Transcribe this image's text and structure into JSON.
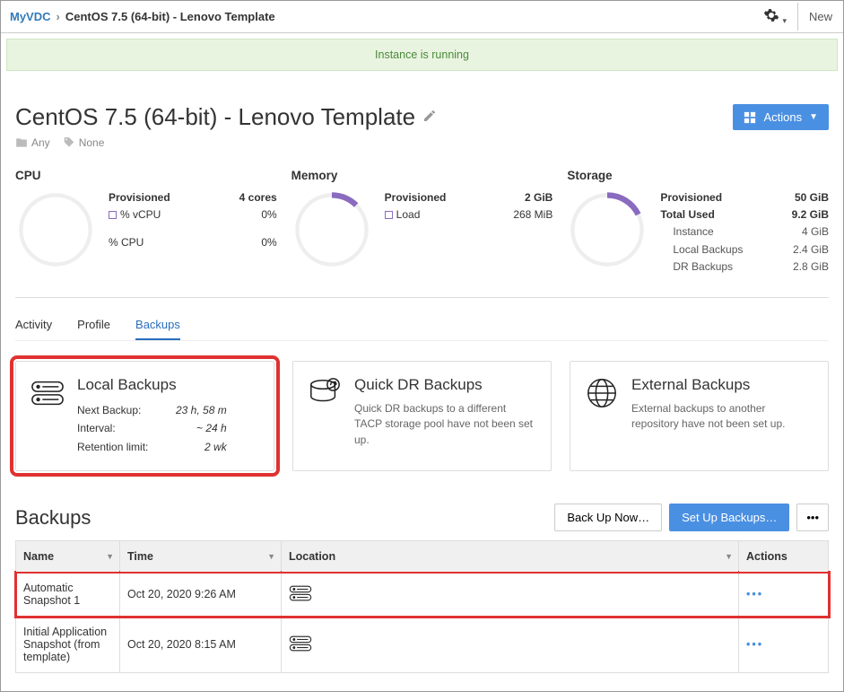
{
  "breadcrumb": {
    "root": "MyVDC",
    "current": "CentOS 7.5 (64-bit) - Lenovo Template"
  },
  "header": {
    "new_label": "New"
  },
  "status_banner": "Instance is running",
  "page_title": "CentOS 7.5 (64-bit) - Lenovo Template",
  "actions_dropdown": "Actions",
  "tags": {
    "folder": "Any",
    "tag": "None"
  },
  "gauges": {
    "cpu": {
      "title": "CPU",
      "rows": [
        {
          "label": "Provisioned",
          "value": "4 cores",
          "bold": true
        },
        {
          "label": "% vCPU",
          "value": "0%",
          "sq": true
        },
        {
          "label": "% CPU",
          "value": "0%"
        }
      ]
    },
    "memory": {
      "title": "Memory",
      "rows": [
        {
          "label": "Provisioned",
          "value": "2 GiB",
          "bold": true
        },
        {
          "label": "Load",
          "value": "268 MiB",
          "sq": true
        }
      ]
    },
    "storage": {
      "title": "Storage",
      "rows": [
        {
          "label": "Provisioned",
          "value": "50 GiB",
          "bold": true
        },
        {
          "label": "Total Used",
          "value": "9.2 GiB",
          "bold": true
        },
        {
          "label": "Instance",
          "value": "4 GiB",
          "indent": true
        },
        {
          "label": "Local Backups",
          "value": "2.4 GiB",
          "indent": true
        },
        {
          "label": "DR Backups",
          "value": "2.8 GiB",
          "indent": true
        }
      ]
    }
  },
  "tabs": {
    "activity": "Activity",
    "profile": "Profile",
    "backups": "Backups"
  },
  "cards": {
    "local": {
      "title": "Local Backups",
      "rows": [
        {
          "k": "Next Backup:",
          "v": "23 h, 58 m"
        },
        {
          "k": "Interval:",
          "v": "~ 24 h"
        },
        {
          "k": "Retention limit:",
          "v": "2 wk"
        }
      ]
    },
    "quickdr": {
      "title": "Quick DR Backups",
      "desc": "Quick DR backups to a different TACP storage pool have not been set up."
    },
    "external": {
      "title": "External Backups",
      "desc": "External backups to another repository have not been set up."
    }
  },
  "backups_section": {
    "title": "Backups",
    "backup_now": "Back Up Now…",
    "setup": "Set Up Backups…",
    "columns": {
      "name": "Name",
      "time": "Time",
      "location": "Location",
      "actions": "Actions"
    },
    "rows": [
      {
        "name": "Automatic Snapshot 1",
        "time": "Oct 20, 2020 9:26 AM",
        "highlight": true
      },
      {
        "name": "Initial Application Snapshot (from template)",
        "time": "Oct 20, 2020 8:15 AM",
        "highlight": false
      }
    ]
  }
}
